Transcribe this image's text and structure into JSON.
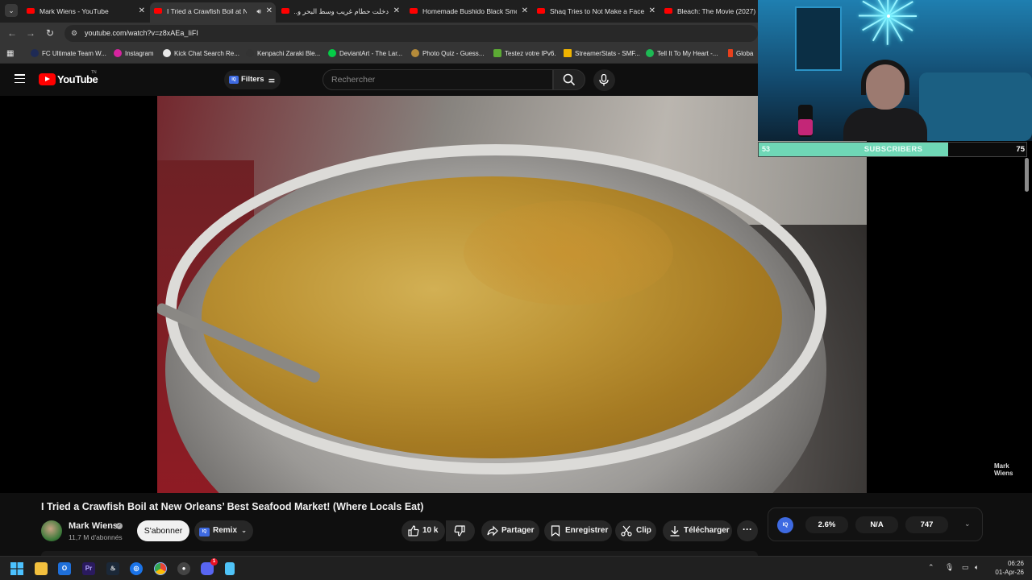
{
  "browser": {
    "tabs": [
      {
        "title": "Mark Wiens - YouTube",
        "active": false
      },
      {
        "title": "I Tried a Crawfish Boil at New",
        "active": true
      },
      {
        "title": "دخلت حطام غريب وسط البحر و...",
        "active": false
      },
      {
        "title": "Homemade Bushido Black Smo",
        "active": false
      },
      {
        "title": "Shaq Tries to Not Make a Face",
        "active": false
      },
      {
        "title": "Bleach: The Movie (2027) | B",
        "active": false
      }
    ],
    "url": "youtube.com/watch?v=z8xAEa_IiFI",
    "bookmarks": [
      {
        "label": "FC Ultimate Team W...",
        "color": "#1e2a55"
      },
      {
        "label": "Instagram",
        "color": "#d6249f"
      },
      {
        "label": "Kick Chat Search Re...",
        "color": "#e8e8e8"
      },
      {
        "label": "Kenpachi Zaraki Ble...",
        "color": "#333333"
      },
      {
        "label": "DeviantArt - The Lar...",
        "color": "#05cc47"
      },
      {
        "label": "Photo Quiz - Guess...",
        "color": "#b58b3a"
      },
      {
        "label": "Testez votre IPv6.",
        "color": "#5caa34"
      },
      {
        "label": "StreamerStats - SMF...",
        "color": "#f0b400"
      },
      {
        "label": "Tell It To My Heart -...",
        "color": "#1db954"
      },
      {
        "label": "Globa",
        "color": "#e8401c"
      }
    ]
  },
  "youtube": {
    "logo_text": "YouTube",
    "logo_country": "TN",
    "filters_label": "Filters",
    "iq_badge": "IQ",
    "search_placeholder": "Rechercher",
    "watermark_line1": "Mark",
    "watermark_line2": "Wiens"
  },
  "overlay": {
    "subscribers_label": "SUBSCRIBERS",
    "current": 53,
    "goal": 75,
    "accent": "#6fd7b6"
  },
  "video": {
    "title": "I Tried a Crawfish Boil at New Orleans’ Best Seafood Market! (Where Locals Eat)",
    "channel": "Mark Wiens",
    "subscribers": "11,7 M d'abonnés",
    "subscribe_label": "S'abonner",
    "remix_label": "Remix",
    "likes": "10 k",
    "share_label": "Partager",
    "save_label": "Enregistrer",
    "clip_label": "Clip",
    "download_label": "Télécharger"
  },
  "iq_panel": {
    "logo": "IQ",
    "stat1": "2.6%",
    "stat2": "N/A",
    "stat3": "747"
  },
  "taskbar": {
    "time": "06:26",
    "date": "01-Apr-26",
    "discord_badge": "1"
  }
}
